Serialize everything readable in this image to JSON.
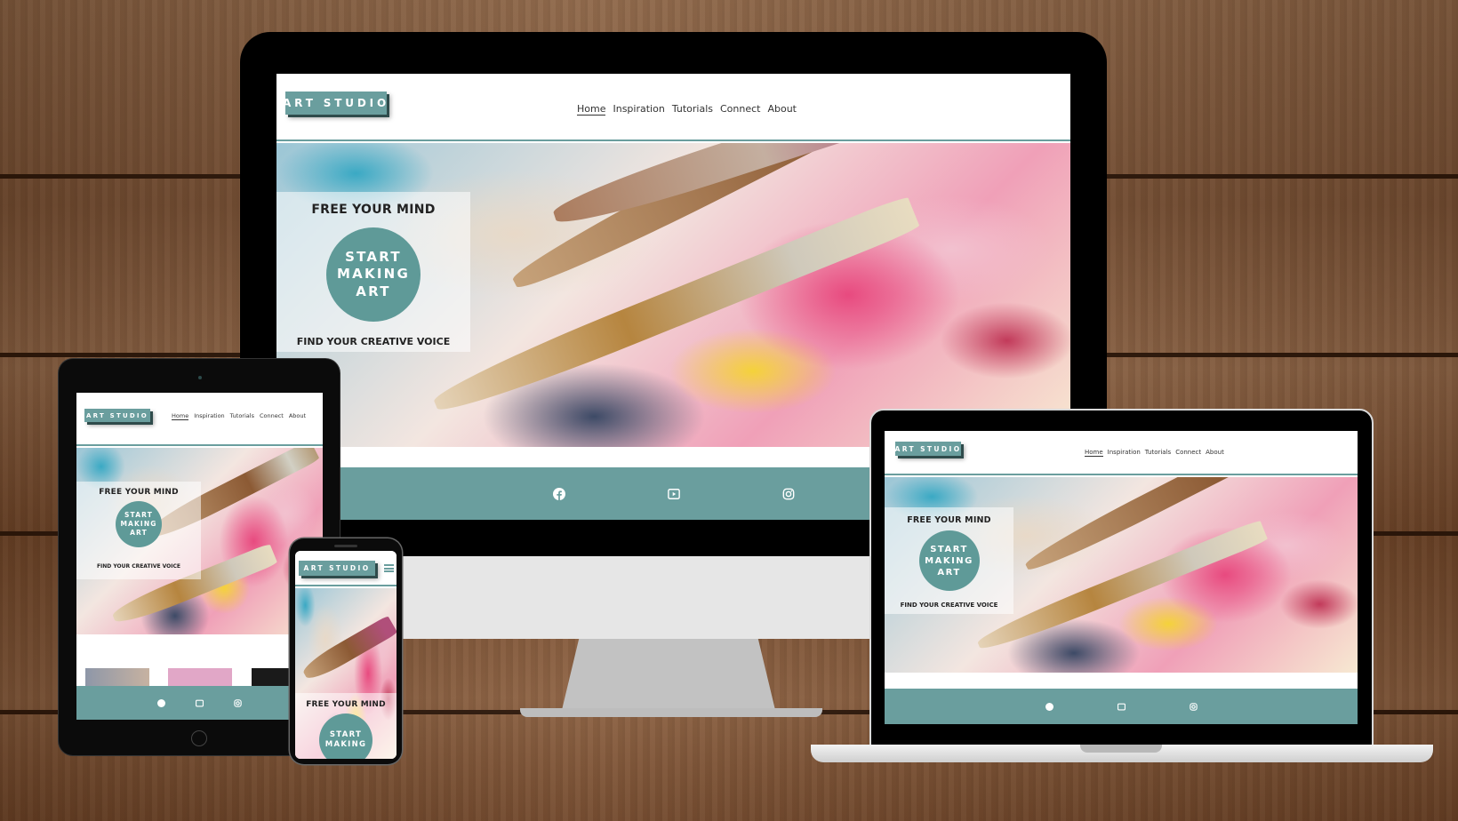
{
  "site": {
    "logo": "ART STUDIO",
    "nav": [
      {
        "label": "Home",
        "active": true
      },
      {
        "label": "Inspiration",
        "active": false
      },
      {
        "label": "Tutorials",
        "active": false
      },
      {
        "label": "Connect",
        "active": false
      },
      {
        "label": "About",
        "active": false
      }
    ],
    "hero": {
      "headline": "FREE YOUR MIND",
      "cta": "START MAKING ART",
      "cta_lines": [
        "START",
        "MAKING",
        "ART"
      ],
      "tagline": "FIND YOUR CREATIVE VOICE"
    },
    "footer_icons": [
      "facebook-icon",
      "youtube-icon",
      "instagram-icon"
    ],
    "colors": {
      "accent": "#6a9e9e",
      "accent_dark": "#2f4b4b"
    }
  }
}
